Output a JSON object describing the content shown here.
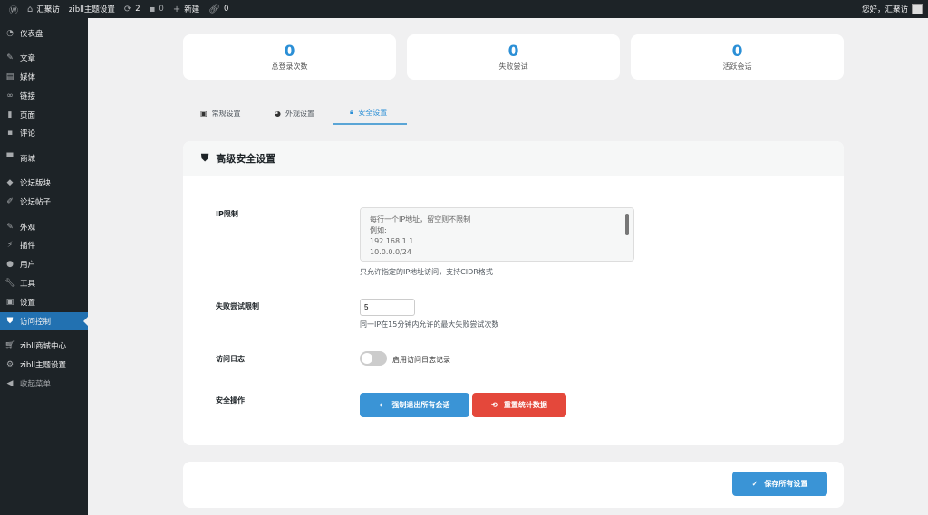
{
  "topbar": {
    "site": "汇聚访",
    "theme": "zibll主题设置",
    "updates": "2",
    "comments": "0",
    "new": "新建",
    "links": "0",
    "greeting": "您好，汇聚访"
  },
  "sidebar": {
    "items": [
      {
        "label": "仪表盘",
        "icon": "dashboard-icon"
      },
      {
        "label": "文章",
        "icon": "pin-icon"
      },
      {
        "label": "媒体",
        "icon": "media-icon"
      },
      {
        "label": "链接",
        "icon": "link-icon"
      },
      {
        "label": "页面",
        "icon": "page-icon"
      },
      {
        "label": "评论",
        "icon": "comment-icon"
      },
      {
        "label": "商城",
        "icon": "store-icon"
      },
      {
        "label": "论坛版块",
        "icon": "forum-icon"
      },
      {
        "label": "论坛帖子",
        "icon": "post-icon"
      },
      {
        "label": "外观",
        "icon": "appearance-icon"
      },
      {
        "label": "插件",
        "icon": "plugin-icon"
      },
      {
        "label": "用户",
        "icon": "user-icon"
      },
      {
        "label": "工具",
        "icon": "tool-icon"
      },
      {
        "label": "设置",
        "icon": "settings-icon"
      },
      {
        "label": "访问控制",
        "icon": "shield-icon"
      },
      {
        "label": "zibll商城中心",
        "icon": "cart-icon"
      },
      {
        "label": "zibll主题设置",
        "icon": "gear-icon"
      },
      {
        "label": "收起菜单",
        "icon": "collapse-icon"
      }
    ]
  },
  "stats": [
    {
      "value": "0",
      "label": "总登录次数"
    },
    {
      "value": "0",
      "label": "失败尝试"
    },
    {
      "value": "0",
      "label": "活跃会话"
    }
  ],
  "tabs": [
    {
      "label": "常规设置"
    },
    {
      "label": "外观设置"
    },
    {
      "label": "安全设置"
    }
  ],
  "section": {
    "title": "高级安全设置",
    "ip_label": "IP限制",
    "ip_placeholder": "每行一个IP地址，留空则不限制\n例如:\n192.168.1.1\n10.0.0.0/24",
    "ip_help": "只允许指定的IP地址访问，支持CIDR格式",
    "fail_label": "失败尝试限制",
    "fail_value": "5",
    "fail_help": "同一IP在15分钟内允许的最大失败尝试次数",
    "log_label": "访问日志",
    "log_toggle": "启用访问日志记录",
    "log_enabled": false,
    "ops_label": "安全操作",
    "logout_btn": "强制退出所有会话",
    "reset_btn": "重置统计数据"
  },
  "save_btn": "保存所有设置"
}
